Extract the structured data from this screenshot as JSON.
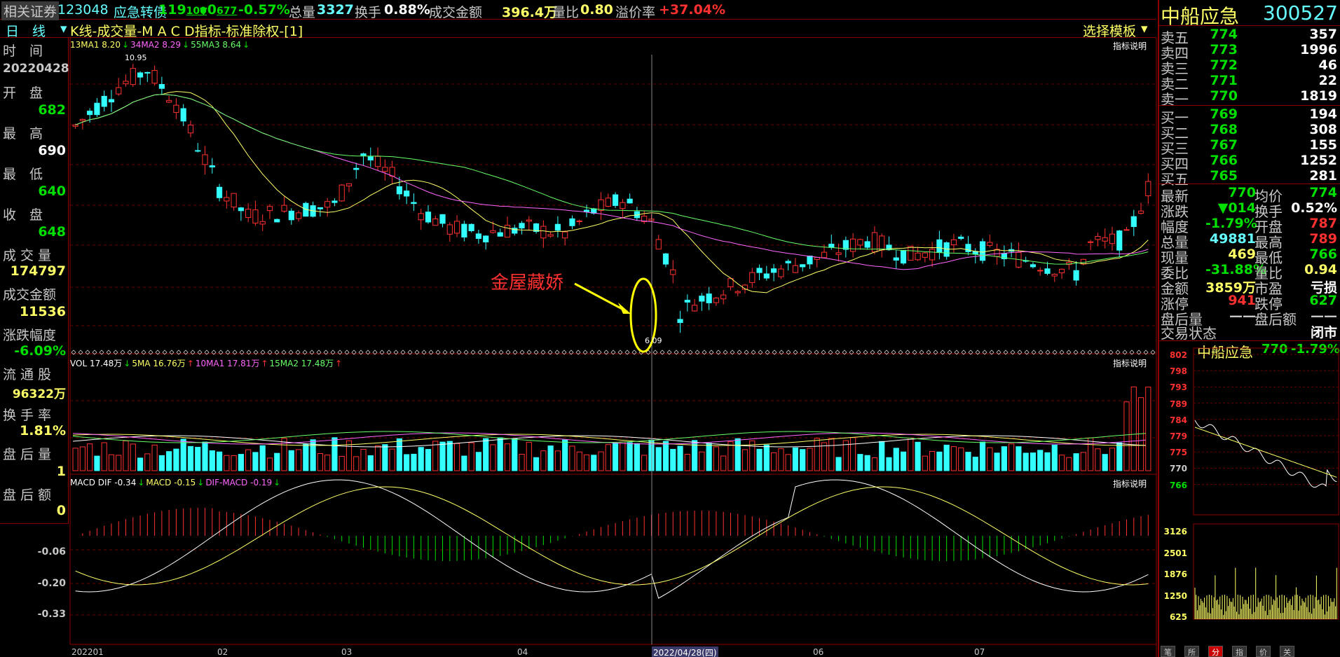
{
  "header": {
    "broker": "相关证券",
    "code": "123048",
    "name": "应急转债",
    "price_main": "119",
    "price_frac": "100",
    "change_arrow": "▼",
    "change_main": "0",
    "change_frac": "677",
    "pct": "-0.57%",
    "vol_label": "总量",
    "vol": "3327",
    "turn_label": "换手",
    "turn": "0.88%",
    "amount_label": "成交金额",
    "amount": "396.4万",
    "ratio_label": "量比",
    "ratio": "0.80",
    "premium_label": "溢价率",
    "premium": "+37.04%"
  },
  "subbar": {
    "period": "日　线",
    "dropdown": "▾",
    "title": "K线-成交量-M A C D指标-标准除权-[1]",
    "template": "选择模板",
    "template_arrow": "▾"
  },
  "left_panel": {
    "time_label": "时　间",
    "time": "20220428",
    "open_label": "开　盘",
    "open": "682",
    "high_label": "最　高",
    "high": "690",
    "low_label": "最　低",
    "low": "640",
    "close_label": "收　盘",
    "close": "648",
    "vol_label": "成 交 量",
    "vol": "174797",
    "amount_label": "成交金额",
    "amount": "11536",
    "pct_label": "涨跌幅度",
    "pct": "-6.09%",
    "float_label": "流 通 股",
    "float": "96322万",
    "turn_label": "换 手 率",
    "turn": "1.81%",
    "after_vol_label": "盘 后 量",
    "after_vol": "1",
    "after_amt_label": "盘 后 额",
    "after_amt": "0"
  },
  "kline": {
    "ma_legend": [
      {
        "text": "13MA1 8.20",
        "color": "#ffff66"
      },
      {
        "text": "↓",
        "color": "#00e000"
      },
      {
        "text": "34MA2 8.29",
        "color": "#ff66ff"
      },
      {
        "text": "↓",
        "color": "#00e000"
      },
      {
        "text": "55MA3 8.64",
        "color": "#66ff66"
      },
      {
        "text": "↓",
        "color": "#00e000"
      }
    ],
    "help": "指标说明",
    "max_label": "10.95",
    "min_label": "6.09",
    "annotation": "金屋藏娇",
    "annotation_color": "#ff3030"
  },
  "volume": {
    "legend": [
      {
        "text": "VOL 17.48万",
        "color": "#ffffff"
      },
      {
        "text": "↓",
        "color": "#00e000"
      },
      {
        "text": "5MA 16.76万",
        "color": "#ffff66"
      },
      {
        "text": "↑",
        "color": "#ff3030"
      },
      {
        "text": "10MA1 17.81万",
        "color": "#ff66ff"
      },
      {
        "text": "↑",
        "color": "#ff3030"
      },
      {
        "text": "15MA2 17.48万",
        "color": "#66ff66"
      },
      {
        "text": "↑",
        "color": "#ff3030"
      }
    ],
    "help": "指标说明"
  },
  "macd": {
    "legend": [
      {
        "text": "MACD DIF -0.34",
        "color": "#ffffff"
      },
      {
        "text": "↓",
        "color": "#00e000"
      },
      {
        "text": "MACD -0.15",
        "color": "#ffff66"
      },
      {
        "text": "↓",
        "color": "#00e000"
      },
      {
        "text": "DIF-MACD -0.19",
        "color": "#ff66ff"
      },
      {
        "text": "↓",
        "color": "#00e000"
      }
    ],
    "help": "指标说明",
    "ticks": [
      "-0.06",
      "-0.20",
      "-0.33"
    ]
  },
  "xaxis": {
    "labels": [
      "202201",
      "02",
      "03",
      "04",
      "06",
      "07"
    ],
    "cursor": "2022/04/28(四)"
  },
  "right_panel": {
    "name": "中船应急",
    "code": "300527",
    "asks": [
      {
        "label": "卖五",
        "price": "774",
        "vol": "357"
      },
      {
        "label": "卖四",
        "price": "773",
        "vol": "1996"
      },
      {
        "label": "卖三",
        "price": "772",
        "vol": "46"
      },
      {
        "label": "卖二",
        "price": "771",
        "vol": "22"
      },
      {
        "label": "卖一",
        "price": "770",
        "vol": "1819"
      }
    ],
    "bids": [
      {
        "label": "买一",
        "price": "769",
        "vol": "194"
      },
      {
        "label": "买二",
        "price": "768",
        "vol": "308"
      },
      {
        "label": "买三",
        "price": "767",
        "vol": "155"
      },
      {
        "label": "买四",
        "price": "766",
        "vol": "1252"
      },
      {
        "label": "买五",
        "price": "765",
        "vol": "281"
      }
    ],
    "stats": [
      {
        "l1": "最新",
        "v1": "770",
        "c1": "#00e000",
        "l2": "均价",
        "v2": "774",
        "c2": "#00e000"
      },
      {
        "l1": "涨跌",
        "v1": "▼014",
        "c1": "#00e000",
        "l2": "换手",
        "v2": "0.52%",
        "c2": "#ffffff"
      },
      {
        "l1": "幅度",
        "v1": "-1.79%",
        "c1": "#00e000",
        "l2": "开盘",
        "v2": "787",
        "c2": "#ff3030"
      },
      {
        "l1": "总量",
        "v1": "49881",
        "c1": "#66ffff",
        "l2": "最高",
        "v2": "789",
        "c2": "#ff3030"
      },
      {
        "l1": "现量",
        "v1": "469",
        "c1": "#ffff66",
        "l2": "最低",
        "v2": "766",
        "c2": "#00e000"
      },
      {
        "l1": "委比",
        "v1": "-31.88%",
        "c1": "#00e000",
        "l2": "量比",
        "v2": "0.94",
        "c2": "#ffff66"
      },
      {
        "l1": "金额",
        "v1": "3859万",
        "c1": "#ffff66",
        "l2": "市盈",
        "v2": "亏损",
        "c2": "#ffffff"
      },
      {
        "l1": "涨停",
        "v1": "941",
        "c1": "#ff3030",
        "l2": "跌停",
        "v2": "627",
        "c2": "#00e000"
      },
      {
        "l1": "盘后量",
        "v1": "——",
        "c1": "#c8c8c8",
        "l2": "盘后额",
        "v2": "——",
        "c2": "#c8c8c8"
      }
    ],
    "status_label": "交易状态",
    "status": "闭市",
    "mini_title": "中船应急",
    "mini_price": "770",
    "mini_pct": "-1.79%",
    "mini_prices": [
      "802",
      "798",
      "793",
      "789",
      "784",
      "779",
      "775",
      "770",
      "766"
    ],
    "mini_vols": [
      "3126",
      "2501",
      "1876",
      "1250",
      "625"
    ],
    "tabs": [
      "笔",
      "所",
      "分",
      "指",
      "价",
      "关"
    ]
  }
}
